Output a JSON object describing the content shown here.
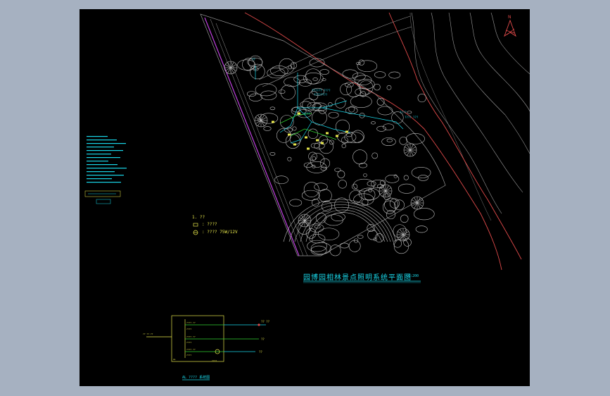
{
  "drawing": {
    "title": "园博园相林景点照明系统平面图",
    "scale": "1:200",
    "legend": {
      "heading": "1. ??",
      "row1": ": ????",
      "row2": ": ???? 75W/12V"
    },
    "system_label": "AL ???? 系统图",
    "circuit_labels": [
      "?? ??",
      "??",
      "??"
    ],
    "colors": {
      "background": "#000000",
      "chrome": "#a6b1c1",
      "cyan": "#19d6e8",
      "yellow": "#e6e64a",
      "green": "#2fd12f",
      "red": "#e04a4a",
      "magenta": "#c040e0",
      "gray": "#9a9a9a",
      "white": "#d8d8d8"
    }
  },
  "icons": {
    "compass": "north-arrow-icon",
    "fixture": "lamp-symbol-icon",
    "panel": "distribution-box-icon"
  }
}
